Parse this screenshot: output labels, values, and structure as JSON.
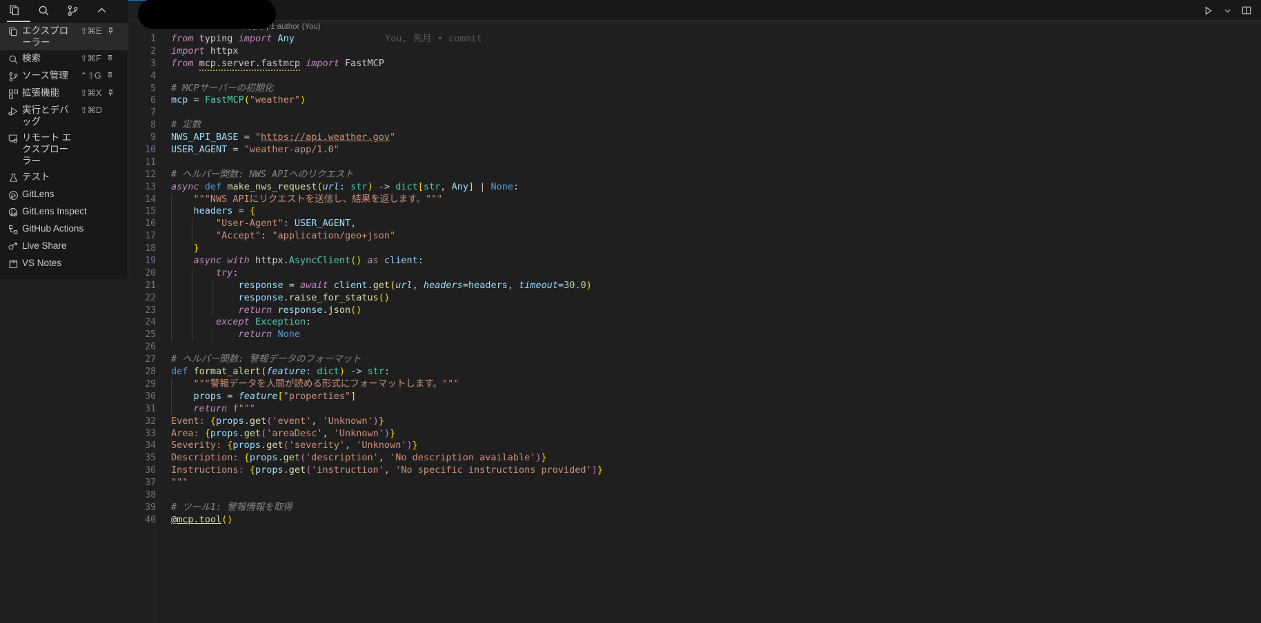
{
  "window": {
    "app": "Visual Studio Code",
    "background": "#1f1f1f",
    "accent": "#0078d4"
  },
  "activity_bar": {
    "icons": [
      {
        "name": "explorer-icon",
        "glyph": "files"
      },
      {
        "name": "search-icon",
        "glyph": "search"
      },
      {
        "name": "source-control-icon",
        "glyph": "git-branch"
      },
      {
        "name": "chevron-up-icon",
        "glyph": "chevron-up"
      }
    ]
  },
  "menu": {
    "items": [
      {
        "label": "エクスプローラー",
        "keys": "⇧⌘E",
        "pin": "📌",
        "icon": "files-icon",
        "highlight": true
      },
      {
        "label": "検索",
        "keys": "⇧⌘F",
        "pin": "📌",
        "icon": "search-icon",
        "highlight": false
      },
      {
        "label": "ソース管理",
        "keys": "⌃⇧G",
        "pin": "📌",
        "icon": "source-control-icon",
        "highlight": false
      },
      {
        "label": "拡張機能",
        "keys": "⇧⌘X",
        "pin": "📌",
        "icon": "extensions-icon",
        "highlight": false
      },
      {
        "label": "実行とデバッグ",
        "keys": "⇧⌘D",
        "pin": "",
        "icon": "run-debug-icon",
        "highlight": false
      },
      {
        "label": "リモート エクスプローラー",
        "keys": "",
        "pin": "",
        "icon": "remote-explorer-icon",
        "highlight": false
      },
      {
        "label": "テスト",
        "keys": "",
        "pin": "",
        "icon": "beaker-icon",
        "highlight": false
      },
      {
        "label": "GitLens",
        "keys": "",
        "pin": "",
        "icon": "gitlens-icon",
        "highlight": false
      },
      {
        "label": "GitLens Inspect",
        "keys": "",
        "pin": "",
        "icon": "gitlens-inspect-icon",
        "highlight": false
      },
      {
        "label": "GitHub Actions",
        "keys": "",
        "pin": "",
        "icon": "github-actions-icon",
        "highlight": false
      },
      {
        "label": "Live Share",
        "keys": "",
        "pin": "",
        "icon": "live-share-icon",
        "highlight": false
      },
      {
        "label": "VS Notes",
        "keys": "",
        "pin": "",
        "icon": "vs-notes-icon",
        "highlight": false
      }
    ]
  },
  "editor": {
    "tab": {
      "label": "",
      "redacted": true,
      "overflow_indicator": "…"
    },
    "toolbar": [
      {
        "name": "run-python-file-button",
        "icon": "play-icon"
      },
      {
        "name": "run-options-dropdown",
        "icon": "chevron-down-icon"
      },
      {
        "name": "split-editor-button",
        "icon": "split-editor-icon"
      }
    ],
    "blame_header": "You, 先月 | 1 author (You)",
    "inline_blame": "You, 先月 • commit",
    "lines": [
      {
        "n": 1,
        "html": "<span class='t-kw'>from</span> <span class='t-plain'>typing</span> <span class='t-kw'>import</span> <span class='t-var'>Any</span>"
      },
      {
        "n": 2,
        "html": "<span class='t-kw'>import</span> <span class='t-plain'>httpx</span>"
      },
      {
        "n": 3,
        "html": "<span class='t-kw'>from</span> <span class='t-plain t-squig'>mcp.server.fastmcp</span> <span class='t-kw'>import</span> <span class='t-plain'>FastMCP</span>"
      },
      {
        "n": 4,
        "html": ""
      },
      {
        "n": 5,
        "html": "<span class='t-comj'># MCPサーバーの初期化</span>"
      },
      {
        "n": 6,
        "html": "<span class='t-var'>mcp</span> <span class='t-op'>=</span> <span class='t-cls'>FastMCP</span><span class='t-brkt-y'>(</span><span class='t-str'>\"weather\"</span><span class='t-brkt-y'>)</span>"
      },
      {
        "n": 7,
        "html": ""
      },
      {
        "n": 8,
        "html": "<span class='t-comj'># 定数</span>"
      },
      {
        "n": 9,
        "html": "<span class='t-var'>NWS_API_BASE</span> <span class='t-op'>=</span> <span class='t-str'>\"</span><span class='t-link'>https://api.weather.gov</span><span class='t-str'>\"</span>"
      },
      {
        "n": 10,
        "html": "<span class='t-var'>USER_AGENT</span> <span class='t-op'>=</span> <span class='t-str'>\"weather-app/1.0\"</span>"
      },
      {
        "n": 11,
        "html": ""
      },
      {
        "n": 12,
        "html": "<span class='t-comj'># ヘルパー関数: NWS APIへのリクエスト</span>"
      },
      {
        "n": 13,
        "html": "<span class='t-ctl'>async</span> <span class='t-kw2'>def</span> <span class='t-fn'>make_nws_request</span><span class='t-brkt-y'>(</span><span class='t-param'>url</span><span class='t-plain'>:</span> <span class='t-cls'>str</span><span class='t-brkt-y'>)</span> <span class='t-op'>-&gt;</span> <span class='t-cls'>dict</span><span class='t-brkt-y'>[</span><span class='t-cls'>str</span><span class='t-plain'>,</span> <span class='t-var'>Any</span><span class='t-brkt-y'>]</span> <span class='t-op'>|</span> <span class='t-kw2'>None</span><span class='t-plain'>:</span>"
      },
      {
        "n": 14,
        "html": "    <span class='t-str'>\"\"\"NWS APIにリクエストを送信し、結果を返します。\"\"\"</span>",
        "indent": 1
      },
      {
        "n": 15,
        "html": "    <span class='t-var'>headers</span> <span class='t-op'>=</span> <span class='t-brkt-y'>{</span>",
        "indent": 1
      },
      {
        "n": 16,
        "html": "        <span class='t-str'>\"User-Agent\"</span><span class='t-plain'>:</span> <span class='t-var'>USER_AGENT</span><span class='t-plain'>,</span>",
        "indent": 2
      },
      {
        "n": 17,
        "html": "        <span class='t-str'>\"Accept\"</span><span class='t-plain'>:</span> <span class='t-str'>\"application/geo+json\"</span>",
        "indent": 2
      },
      {
        "n": 18,
        "html": "    <span class='t-brkt-y'>}</span>",
        "indent": 1
      },
      {
        "n": 19,
        "html": "    <span class='t-ctl'>async</span> <span class='t-ctl'>with</span> <span class='t-plain'>httpx</span><span class='t-plain'>.</span><span class='t-cls'>AsyncClient</span><span class='t-brkt-y'>()</span> <span class='t-ctl'>as</span> <span class='t-var'>client</span><span class='t-plain'>:</span>",
        "indent": 1
      },
      {
        "n": 20,
        "html": "        <span class='t-ctl'>try</span><span class='t-plain'>:</span>",
        "indent": 2
      },
      {
        "n": 21,
        "html": "            <span class='t-var'>response</span> <span class='t-op'>=</span> <span class='t-ctl'>await</span> <span class='t-var'>client</span><span class='t-plain'>.</span><span class='t-fn'>get</span><span class='t-brkt-y'>(</span><span class='t-param'>url</span><span class='t-plain'>,</span> <span class='t-param'>headers</span><span class='t-op'>=</span><span class='t-var'>headers</span><span class='t-plain'>,</span> <span class='t-param'>timeout</span><span class='t-op'>=</span><span class='t-num'>30.0</span><span class='t-brkt-y'>)</span>",
        "indent": 3
      },
      {
        "n": 22,
        "html": "            <span class='t-var'>response</span><span class='t-plain'>.</span><span class='t-fn'>raise_for_status</span><span class='t-brkt-y'>()</span>",
        "indent": 3
      },
      {
        "n": 23,
        "html": "            <span class='t-ctl'>return</span> <span class='t-var'>response</span><span class='t-plain'>.</span><span class='t-fn'>json</span><span class='t-brkt-y'>()</span>",
        "indent": 3
      },
      {
        "n": 24,
        "html": "        <span class='t-ctl'>except</span> <span class='t-cls'>Exception</span><span class='t-plain'>:</span>",
        "indent": 2
      },
      {
        "n": 25,
        "html": "            <span class='t-ctl'>return</span> <span class='t-kw2'>None</span>",
        "indent": 3
      },
      {
        "n": 26,
        "html": ""
      },
      {
        "n": 27,
        "html": "<span class='t-comj'># ヘルパー関数: 警報データのフォーマット</span>"
      },
      {
        "n": 28,
        "html": "<span class='t-kw2'>def</span> <span class='t-fn'>format_alert</span><span class='t-brkt-y'>(</span><span class='t-param'>feature</span><span class='t-plain'>:</span> <span class='t-cls'>dict</span><span class='t-brkt-y'>)</span> <span class='t-op'>-&gt;</span> <span class='t-cls'>str</span><span class='t-plain'>:</span>"
      },
      {
        "n": 29,
        "html": "    <span class='t-str'>\"\"\"警報データを人間が読める形式にフォーマットします。\"\"\"</span>",
        "indent": 1
      },
      {
        "n": 30,
        "html": "    <span class='t-var'>props</span> <span class='t-op'>=</span> <span class='t-param'>feature</span><span class='t-brkt-y'>[</span><span class='t-str'>\"properties\"</span><span class='t-brkt-y'>]</span>",
        "indent": 1
      },
      {
        "n": 31,
        "html": "    <span class='t-ctl'>return</span> <span class='t-str'>f\"\"\"</span>",
        "indent": 1
      },
      {
        "n": 32,
        "html": "<span class='t-str'>Event: </span><span class='t-brkt-y'>{</span><span class='t-var'>props</span><span class='t-plain'>.</span><span class='t-fn'>get</span><span class='t-brkt-p'>(</span><span class='t-str'>'event'</span><span class='t-plain'>,</span> <span class='t-str'>'Unknown'</span><span class='t-brkt-p'>)</span><span class='t-brkt-y'>}</span>"
      },
      {
        "n": 33,
        "html": "<span class='t-str'>Area: </span><span class='t-brkt-y'>{</span><span class='t-var'>props</span><span class='t-plain'>.</span><span class='t-fn'>get</span><span class='t-brkt-p'>(</span><span class='t-str'>'areaDesc'</span><span class='t-plain'>,</span> <span class='t-str'>'Unknown'</span><span class='t-brkt-p'>)</span><span class='t-brkt-y'>}</span>"
      },
      {
        "n": 34,
        "html": "<span class='t-str'>Severity: </span><span class='t-brkt-y'>{</span><span class='t-var'>props</span><span class='t-plain'>.</span><span class='t-fn'>get</span><span class='t-brkt-p'>(</span><span class='t-str'>'severity'</span><span class='t-plain'>,</span> <span class='t-str'>'Unknown'</span><span class='t-brkt-p'>)</span><span class='t-brkt-y'>}</span>"
      },
      {
        "n": 35,
        "html": "<span class='t-str'>Description: </span><span class='t-brkt-y'>{</span><span class='t-var'>props</span><span class='t-plain'>.</span><span class='t-fn'>get</span><span class='t-brkt-p'>(</span><span class='t-str'>'description'</span><span class='t-plain'>,</span> <span class='t-str'>'No description available'</span><span class='t-brkt-p'>)</span><span class='t-brkt-y'>}</span>"
      },
      {
        "n": 36,
        "html": "<span class='t-str'>Instructions: </span><span class='t-brkt-y'>{</span><span class='t-var'>props</span><span class='t-plain'>.</span><span class='t-fn'>get</span><span class='t-brkt-p'>(</span><span class='t-str'>'instruction'</span><span class='t-plain'>,</span> <span class='t-str'>'No specific instructions provided'</span><span class='t-brkt-p'>)</span><span class='t-brkt-y'>}</span>"
      },
      {
        "n": 37,
        "html": "<span class='t-str'>\"\"\"</span>"
      },
      {
        "n": 38,
        "html": ""
      },
      {
        "n": 39,
        "html": "<span class='t-comj'># ツール1: 警報情報を取得</span>"
      },
      {
        "n": 40,
        "html": "<span class='t-deco'>@mcp.tool</span><span class='t-brkt-y'>()</span>"
      }
    ]
  }
}
